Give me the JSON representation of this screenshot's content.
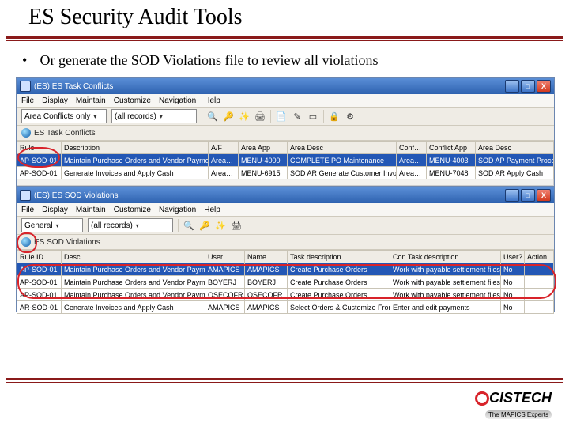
{
  "slide": {
    "title": "ES Security Audit Tools",
    "bullet": "Or generate the SOD Violations file to review all violations"
  },
  "logo": {
    "name": "CISTECH",
    "tagline": "The MAPICS Experts"
  },
  "window1": {
    "title": "(ES) ES Task Conflicts",
    "menu": [
      "File",
      "Display",
      "Maintain",
      "Customize",
      "Navigation",
      "Help"
    ],
    "dd1": "Area Conflicts only",
    "dd2": "(all records)",
    "subhead": "ES Task Conflicts",
    "btn_min": "_",
    "btn_max": "□",
    "btn_close": "X",
    "cols": [
      "Rule",
      "Description",
      "A/F",
      "Area App",
      "Area Desc",
      "Conf…",
      "Conflict App",
      "Area Desc"
    ],
    "rows": [
      [
        "AP-SOD-01",
        "Maintain Purchase Orders and Vendor Payments",
        "Area…",
        "MENU-4000",
        "COMPLETE PO Maintenance",
        "Area…",
        "MENU-4003",
        "SOD AP Payment Processing"
      ],
      [
        "AP-SOD-01",
        "Generate Invoices and Apply Cash",
        "Area…",
        "MENU-6915",
        "SOD AR Generate Customer Invoices",
        "Area…",
        "MENU-7048",
        "SOD AR Apply Cash"
      ]
    ]
  },
  "window2": {
    "title": "(ES) ES SOD Violations",
    "menu": [
      "File",
      "Display",
      "Maintain",
      "Customize",
      "Navigation",
      "Help"
    ],
    "dd1": "General",
    "dd2": "(all records)",
    "subhead": "ES SOD Violations",
    "btn_min": "_",
    "btn_max": "□",
    "btn_close": "X",
    "cols": [
      "Rule ID",
      "Desc",
      "User",
      "Name",
      "Task description",
      "Con Task description",
      "User?",
      "Action"
    ],
    "rows": [
      [
        "AP-SOD-01",
        "Maintain Purchase Orders and Vendor Payments",
        "AMAPICS",
        "AMAPICS",
        "Create Purchase Orders",
        "Work with payable settlement files",
        "No",
        ""
      ],
      [
        "AP-SOD-01",
        "Maintain Purchase Orders and Vendor Payments",
        "BOYERJ",
        "BOYERJ",
        "Create Purchase Orders",
        "Work with payable settlement files",
        "No",
        ""
      ],
      [
        "AP-SOD-01",
        "Maintain Purchase Orders and Vendor Payments",
        "QSECOFR",
        "QSECOFR",
        "Create Purchase Orders",
        "Work with payable settlement files",
        "No",
        ""
      ],
      [
        "AR-SOD-01",
        "Generate Invoices and Apply Cash",
        "AMAPICS",
        "AMAPICS",
        "Select Orders & Customize From Invoicing",
        "Enter and edit payments",
        "No",
        ""
      ]
    ]
  },
  "icons": {
    "binoc": "🔍",
    "key": "🔑",
    "print": "🖨",
    "lock": "🔒",
    "page": "📄",
    "pencil": "✎",
    "card": "▭",
    "cog": "⚙",
    "wand": "✨",
    "chev": "▾"
  }
}
